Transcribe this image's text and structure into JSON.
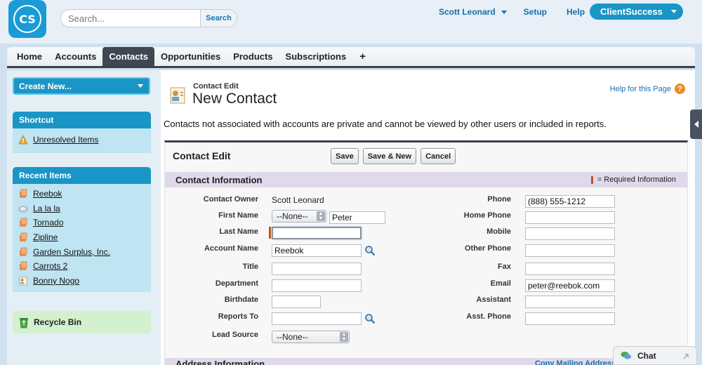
{
  "header": {
    "logo_text": "CS",
    "search_placeholder": "Search...",
    "search_button": "Search",
    "user_menu": "Scott Leonard",
    "setup": "Setup",
    "help": "Help",
    "app_switcher": "ClientSuccess"
  },
  "tabs": [
    {
      "label": "Home"
    },
    {
      "label": "Accounts"
    },
    {
      "label": "Contacts"
    },
    {
      "label": "Opportunities"
    },
    {
      "label": "Products"
    },
    {
      "label": "Subscriptions"
    },
    {
      "label": "+"
    }
  ],
  "active_tab": "Contacts",
  "sidebar": {
    "create_new": "Create New...",
    "shortcut": {
      "title": "Shortcut",
      "items": [
        {
          "label": "Unresolved Items",
          "icon": "warning-icon"
        }
      ]
    },
    "recent": {
      "title": "Recent Items",
      "items": [
        {
          "label": "Reebok",
          "icon": "account-icon"
        },
        {
          "label": "La la la",
          "icon": "case-icon"
        },
        {
          "label": "Tornado",
          "icon": "account-icon"
        },
        {
          "label": "Zipline",
          "icon": "account-icon"
        },
        {
          "label": "Garden Surplus, Inc.",
          "icon": "account-icon"
        },
        {
          "label": "Carrots 2",
          "icon": "account-icon"
        },
        {
          "label": "Bonny Nogo",
          "icon": "contact-icon"
        }
      ]
    },
    "recycle_bin": "Recycle Bin"
  },
  "page": {
    "breadcrumb": "Contact Edit",
    "title": "New Contact",
    "help_link": "Help for this Page",
    "help_q": "?",
    "notice": "Contacts not associated with accounts are private and cannot be viewed by other users or included in reports."
  },
  "form": {
    "block_title": "Contact Edit",
    "buttons": {
      "save": "Save",
      "save_new": "Save & New",
      "cancel": "Cancel"
    },
    "section_title": "Contact Information",
    "required_note": "= Required Information",
    "labels": {
      "owner": "Contact Owner",
      "first_name": "First Name",
      "last_name": "Last Name",
      "account_name": "Account Name",
      "title": "Title",
      "department": "Department",
      "birthdate": "Birthdate",
      "reports_to": "Reports To",
      "lead_source": "Lead Source",
      "phone": "Phone",
      "home_phone": "Home Phone",
      "mobile": "Mobile",
      "other_phone": "Other Phone",
      "fax": "Fax",
      "email": "Email",
      "assistant": "Assistant",
      "asst_phone": "Asst. Phone"
    },
    "values": {
      "owner": "Scott Leonard",
      "salutation": "--None--",
      "first_name": "Peter",
      "last_name": "",
      "account_name": "Reebok",
      "title": "",
      "department": "",
      "birthdate": "",
      "reports_to": "",
      "lead_source": "--None--",
      "phone": "(888) 555-1212",
      "home_phone": "",
      "mobile": "",
      "other_phone": "",
      "fax": "",
      "email": "peter@reebok.com",
      "assistant": "",
      "asst_phone": ""
    },
    "next_section": "Address Information",
    "copy_mailing": "Copy Mailing Address"
  },
  "chat": {
    "label": "Chat"
  },
  "colors": {
    "accent": "#1a96c6",
    "required": "#c0541e",
    "tab_dark": "#3f4751"
  }
}
